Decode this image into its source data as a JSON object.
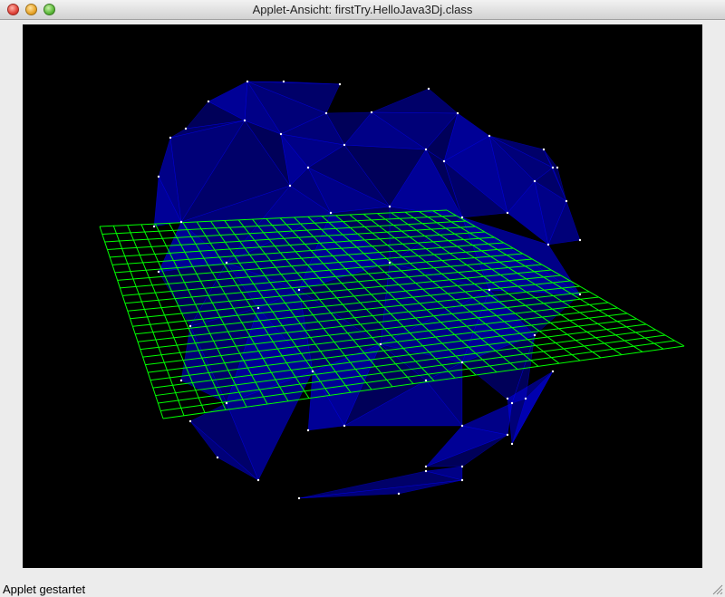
{
  "window": {
    "title": "Applet-Ansicht: firstTry.HelloJava3Dj.class",
    "buttons": {
      "close": "close",
      "minimize": "minimize",
      "zoom": "zoom"
    }
  },
  "scene": {
    "background": "#000000",
    "mesh_color": "#0000ff",
    "grid_color": "#00ff00",
    "vertex_color": "#ffffff"
  },
  "status": {
    "text": "Applet gestartet"
  },
  "icons": {
    "resize": "resize-grip-icon"
  }
}
